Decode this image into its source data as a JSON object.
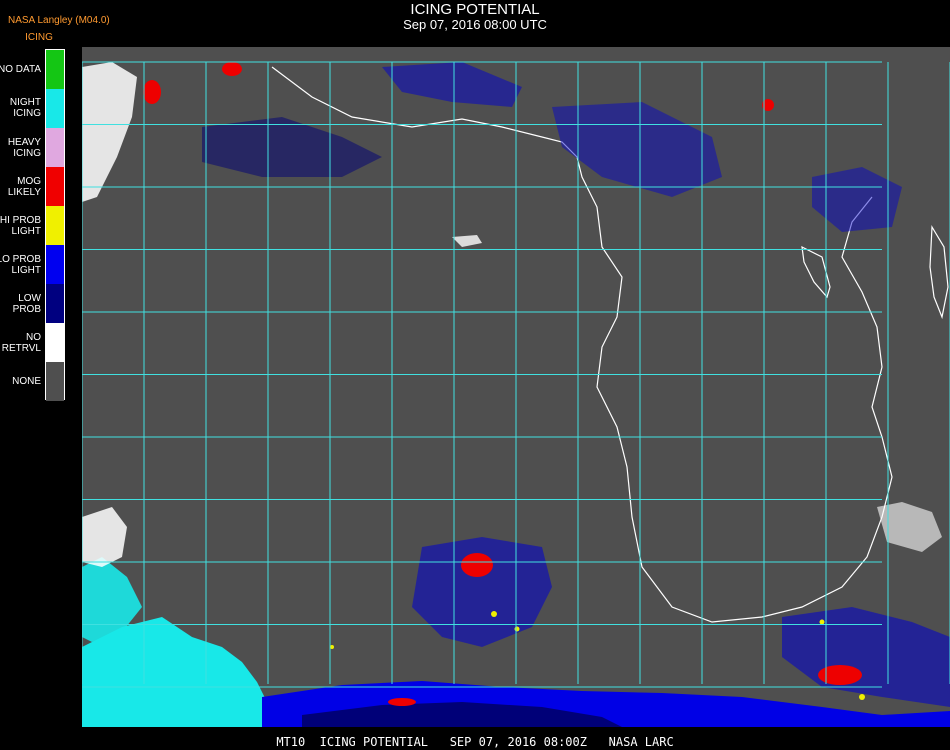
{
  "header": {
    "title": "ICING POTENTIAL",
    "timestamp": "Sep 07, 2016 08:00 UTC",
    "producer": "NASA Langley (M04.0)",
    "product": "ICING"
  },
  "legend": {
    "items": [
      {
        "label": "NO DATA",
        "color": "#14c614"
      },
      {
        "label": "NIGHT\nICING",
        "color": "#18e8e8"
      },
      {
        "label": "HEAVY\nICING",
        "color": "#e0a8e0"
      },
      {
        "label": "MOG\nLIKELY",
        "color": "#f00000"
      },
      {
        "label": "HI PROB\nLIGHT",
        "color": "#f0f000"
      },
      {
        "label": "LO PROB\nLIGHT",
        "color": "#0000f0"
      },
      {
        "label": "LOW\nPROB",
        "color": "#000080"
      },
      {
        "label": "NO\nRETRVL",
        "color": "#ffffff"
      },
      {
        "label": "NONE",
        "color": "#4f4f4f"
      }
    ]
  },
  "footer": {
    "text": "MT10  ICING POTENTIAL   SEP 07, 2016 08:00Z   NASA LARC"
  },
  "colors": {
    "background": "#000000",
    "map_fill": "#4f4f4f",
    "grid": "#40e0e0",
    "coastline": "#ffffff",
    "title_text": "#ffffff",
    "producer_text": "#ff9a30"
  }
}
